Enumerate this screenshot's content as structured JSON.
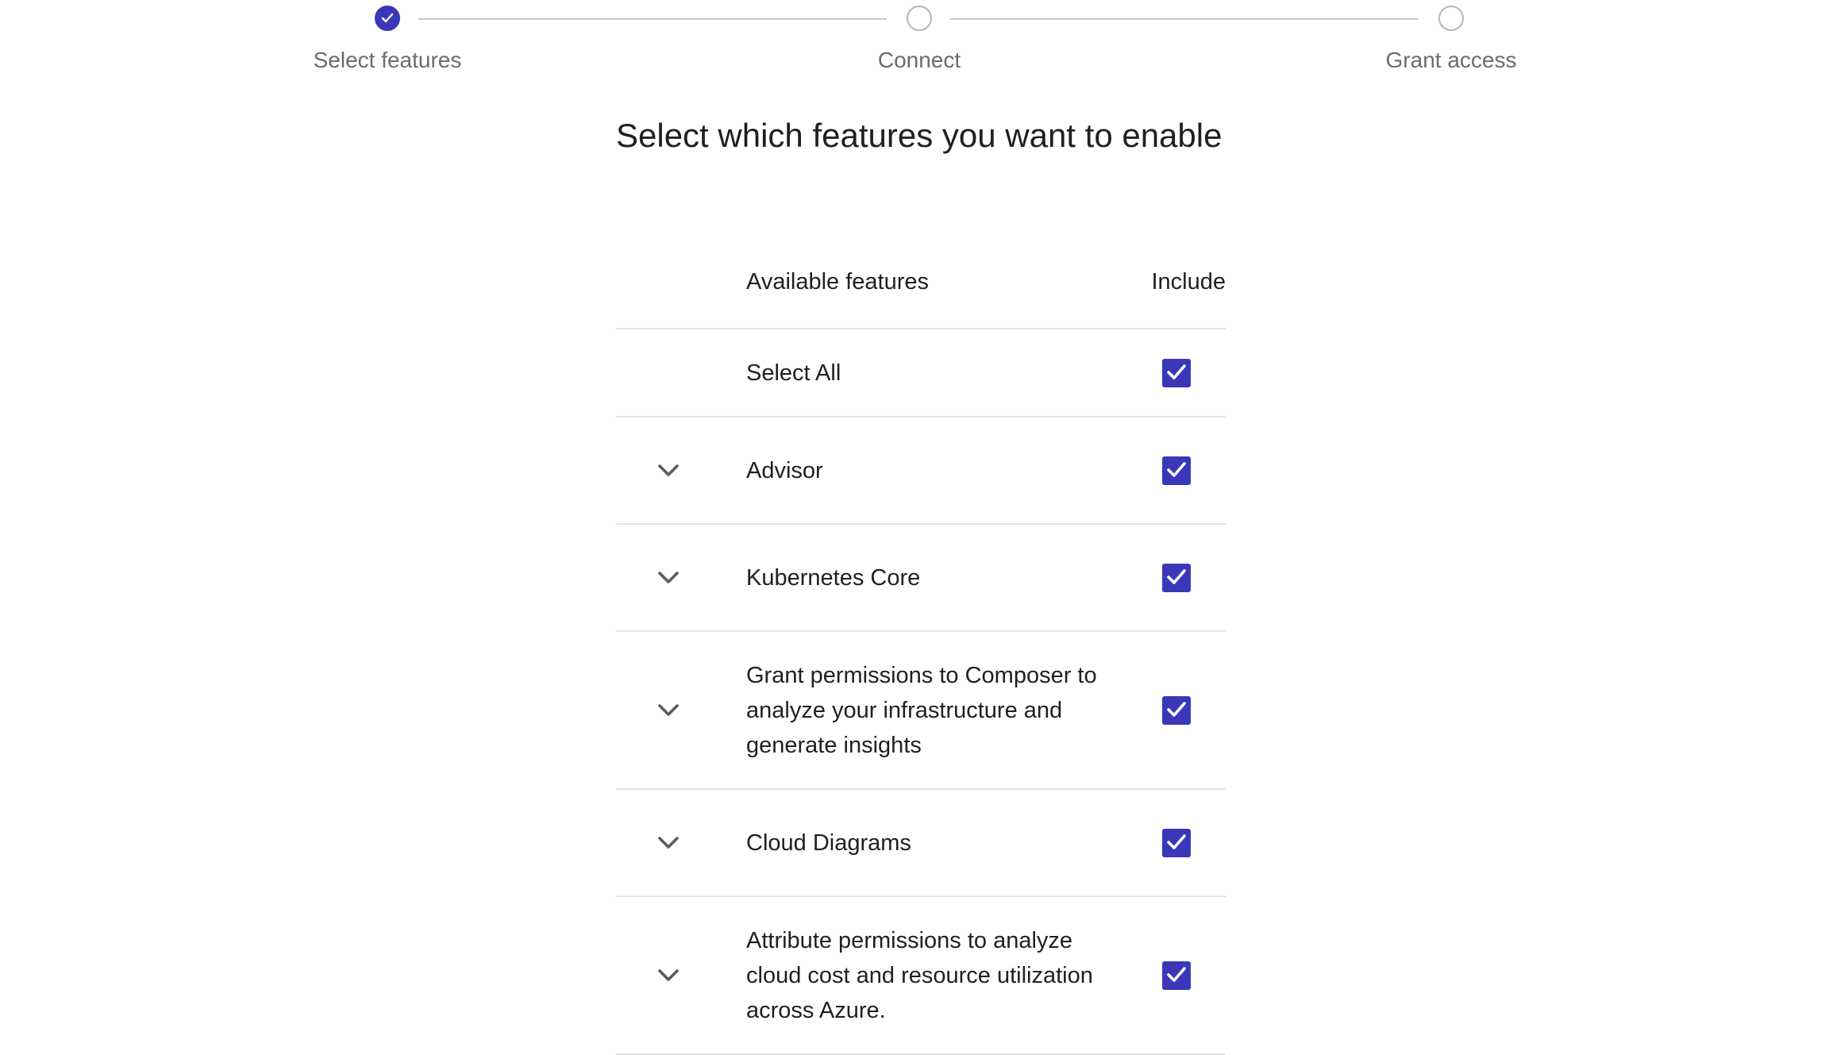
{
  "colors": {
    "accent": "#3a38b8",
    "border": "#e4e4e7",
    "muted_text": "#6b6b70"
  },
  "stepper": {
    "steps": [
      {
        "label": "Select features",
        "state": "completed",
        "icon": "check-icon"
      },
      {
        "label": "Connect",
        "state": "pending"
      },
      {
        "label": "Grant access",
        "state": "pending"
      }
    ]
  },
  "page": {
    "heading": "Select which features you want to enable"
  },
  "features_table": {
    "headers": {
      "feature": "Available features",
      "include": "Include"
    },
    "select_all": {
      "label": "Select All",
      "checked": true
    },
    "rows": [
      {
        "label": "Advisor",
        "checked": true,
        "expand_icon": "chevron-down-icon"
      },
      {
        "label": "Kubernetes Core",
        "checked": true,
        "expand_icon": "chevron-down-icon"
      },
      {
        "label": "Grant permissions to Composer to analyze your infrastructure and generate insights",
        "checked": true,
        "expand_icon": "chevron-down-icon"
      },
      {
        "label": "Cloud Diagrams",
        "checked": true,
        "expand_icon": "chevron-down-icon"
      },
      {
        "label": "Attribute permissions to analyze cloud cost and resource utilization across Azure.",
        "checked": true,
        "expand_icon": "chevron-down-icon"
      }
    ]
  }
}
